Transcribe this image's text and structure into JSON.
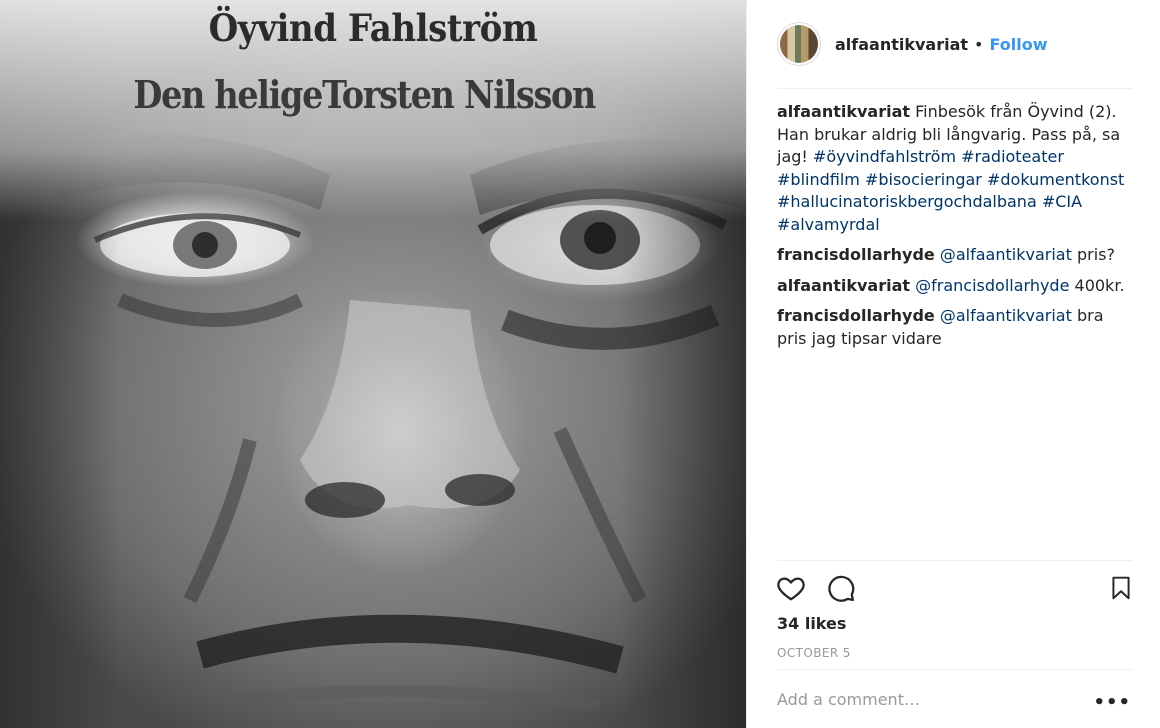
{
  "photo": {
    "book_author": "Öyvind Fahlström",
    "book_title": "Den heligeTorsten Nilsson"
  },
  "header": {
    "username": "alfaantikvariat",
    "separator": "•",
    "follow_label": "Follow"
  },
  "comments": [
    {
      "user": "alfaantikvariat",
      "text": "Finbesök från Öyvind (2). Han brukar aldrig bli långvarig. Pass på, sa jag!",
      "tags": [
        "#öyvindfahlström",
        "#radioteater",
        "#blindfilm",
        "#bisocieringar",
        "#dokumentkonst",
        "#hallucinatoriskbergochdalbana",
        "#CIA",
        "#alvamyrdal"
      ]
    },
    {
      "user": "francisdollarhyde",
      "mention": "@alfaantikvariat",
      "text": "pris?"
    },
    {
      "user": "alfaantikvariat",
      "mention": "@francisdollarhyde",
      "text": "400kr."
    },
    {
      "user": "francisdollarhyde",
      "mention": "@alfaantikvariat",
      "text": "bra pris jag tipsar vidare"
    }
  ],
  "actions": {
    "like_icon": "heart-icon",
    "comment_icon": "speech-bubble-icon",
    "save_icon": "bookmark-icon"
  },
  "likes": "34 likes",
  "date": "OCTOBER 5",
  "add_comment": {
    "placeholder": "Add a comment…",
    "more_label": "•••"
  },
  "colors": {
    "link": "#003569",
    "follow": "#3897f0",
    "muted": "#999999",
    "text": "#262626"
  }
}
